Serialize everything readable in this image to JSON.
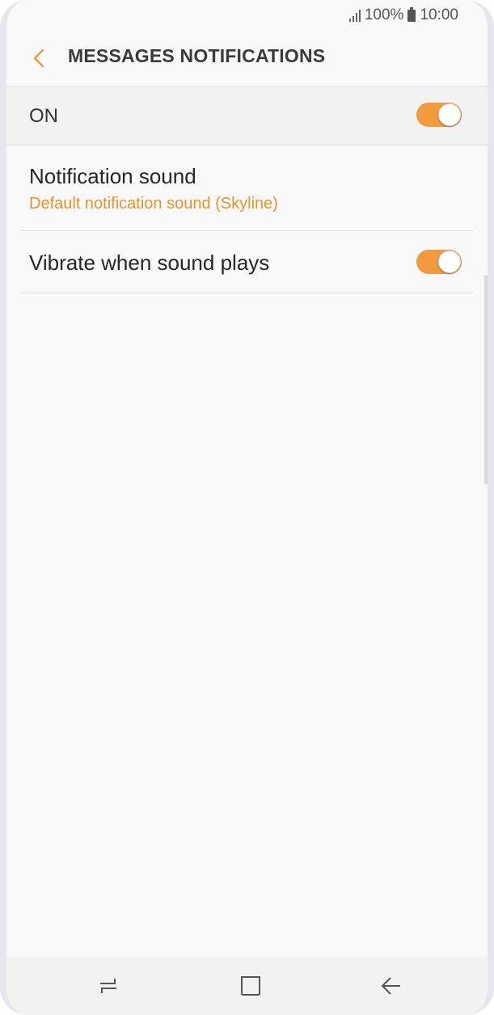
{
  "status_bar": {
    "battery_percent": "100%",
    "time": "10:00",
    "icons": [
      "signal-icon",
      "battery-icon"
    ]
  },
  "header": {
    "title": "MESSAGES NOTIFICATIONS",
    "back_icon": "chevron-left-icon"
  },
  "master_switch": {
    "label": "ON",
    "enabled": true
  },
  "settings": [
    {
      "title": "Notification sound",
      "subtitle": "Default notification sound (Skyline)"
    },
    {
      "title": "Vibrate when sound plays",
      "enabled": true
    }
  ],
  "nav_bar": {
    "icons": [
      "recent-apps-icon",
      "home-icon",
      "back-icon"
    ]
  },
  "colors": {
    "accent": "#f39a40",
    "subtitle": "#e8912f",
    "background": "#f9f9f9"
  }
}
